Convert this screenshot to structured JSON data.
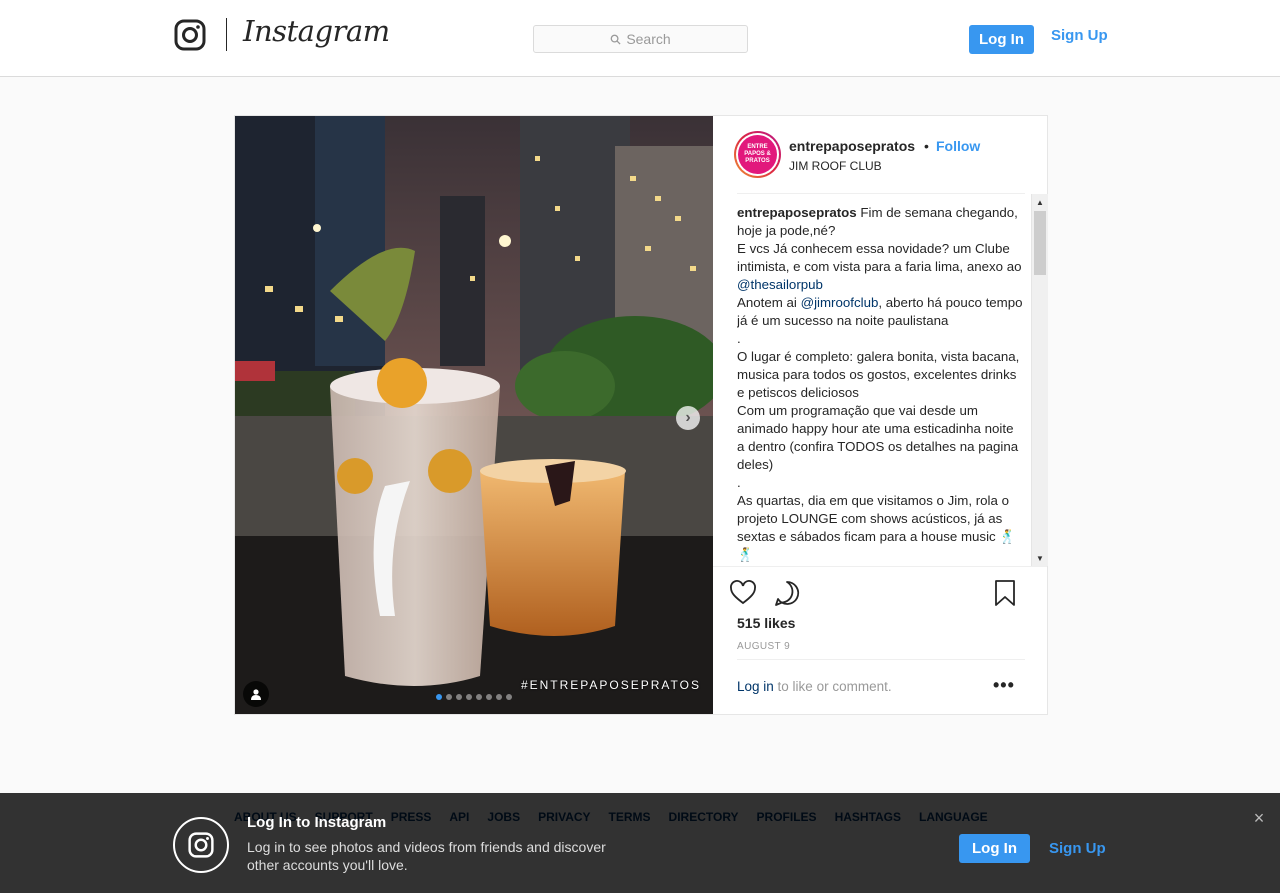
{
  "header": {
    "brand": "Instagram",
    "search_placeholder": "Search",
    "login_label": "Log In",
    "signup_label": "Sign Up"
  },
  "post": {
    "username": "entrepaposepratos",
    "follow_label": "Follow",
    "bullet": "•",
    "location": "JIM ROOF CLUB",
    "avatar_text": "ENTRE PAPOS & PRATOS",
    "watermark": "#ENTREPAPOSEPRATOS",
    "carousel_total": 8,
    "carousel_index": 1,
    "caption": {
      "username": "entrepaposepratos",
      "lines": [
        " Fim de semana chegando, hoje ja pode,né?",
        "E vcs Já conhecem essa novidade? um Clube intimista, e com vista para a faria lima, anexo ao ",
        "@thesailorpub",
        "Anotem ai ",
        "@jimroofclub",
        ", aberto há pouco tempo já é um sucesso na noite paulistana",
        ".",
        "O lugar é completo: galera bonita, vista bacana, musica para todos os gostos, excelentes drinks e petiscos deliciosos",
        "Com um programação que vai desde um animado happy hour ate uma esticadinha noite a dentro (confira TODOS os detalhes na pagina deles)",
        ".",
        "As quartas, dia em que visitamos o Jim, rola o projeto LOUNGE com shows acústicos, já as sextas e sábados ficam para a house music 🕺🕺"
      ]
    },
    "likes": "515 likes",
    "date": "AUGUST 9",
    "login_link": "Log in",
    "login_suffix": " to like or comment.",
    "more": "•••"
  },
  "footer": {
    "links": [
      "ABOUT US",
      "SUPPORT",
      "PRESS",
      "API",
      "JOBS",
      "PRIVACY",
      "TERMS",
      "DIRECTORY",
      "PROFILES",
      "HASHTAGS",
      "LANGUAGE"
    ]
  },
  "banner": {
    "title": "Log In to Instagram",
    "text": "Log in to see photos and videos from friends and discover other accounts you'll love.",
    "login_label": "Log In",
    "signup_label": "Sign Up",
    "close": "×"
  },
  "colors": {
    "accent": "#3897f0",
    "link": "#003569",
    "banner_bg": "#333333"
  }
}
